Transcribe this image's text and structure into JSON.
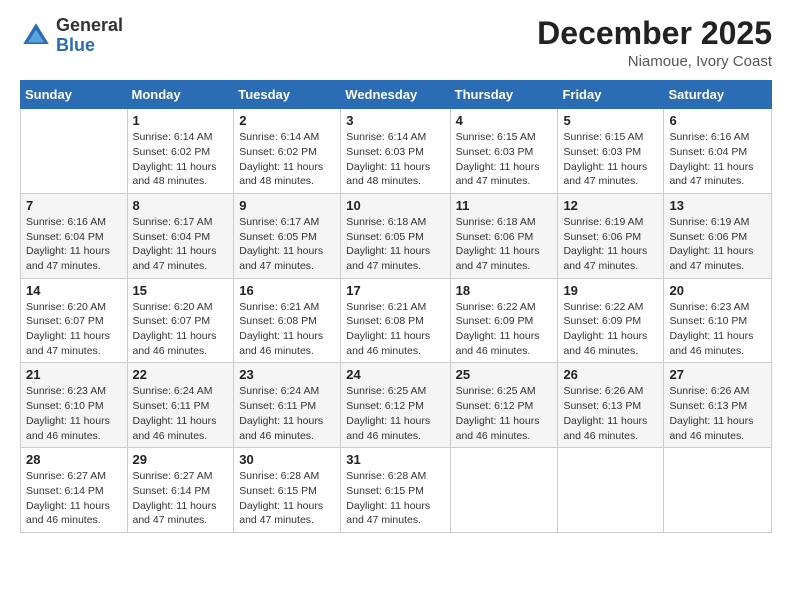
{
  "logo": {
    "general": "General",
    "blue": "Blue"
  },
  "title": "December 2025",
  "location": "Niamoue, Ivory Coast",
  "days_header": [
    "Sunday",
    "Monday",
    "Tuesday",
    "Wednesday",
    "Thursday",
    "Friday",
    "Saturday"
  ],
  "weeks": [
    [
      {
        "day": "",
        "info": ""
      },
      {
        "day": "1",
        "info": "Sunrise: 6:14 AM\nSunset: 6:02 PM\nDaylight: 11 hours\nand 48 minutes."
      },
      {
        "day": "2",
        "info": "Sunrise: 6:14 AM\nSunset: 6:02 PM\nDaylight: 11 hours\nand 48 minutes."
      },
      {
        "day": "3",
        "info": "Sunrise: 6:14 AM\nSunset: 6:03 PM\nDaylight: 11 hours\nand 48 minutes."
      },
      {
        "day": "4",
        "info": "Sunrise: 6:15 AM\nSunset: 6:03 PM\nDaylight: 11 hours\nand 47 minutes."
      },
      {
        "day": "5",
        "info": "Sunrise: 6:15 AM\nSunset: 6:03 PM\nDaylight: 11 hours\nand 47 minutes."
      },
      {
        "day": "6",
        "info": "Sunrise: 6:16 AM\nSunset: 6:04 PM\nDaylight: 11 hours\nand 47 minutes."
      }
    ],
    [
      {
        "day": "7",
        "info": "Sunrise: 6:16 AM\nSunset: 6:04 PM\nDaylight: 11 hours\nand 47 minutes."
      },
      {
        "day": "8",
        "info": "Sunrise: 6:17 AM\nSunset: 6:04 PM\nDaylight: 11 hours\nand 47 minutes."
      },
      {
        "day": "9",
        "info": "Sunrise: 6:17 AM\nSunset: 6:05 PM\nDaylight: 11 hours\nand 47 minutes."
      },
      {
        "day": "10",
        "info": "Sunrise: 6:18 AM\nSunset: 6:05 PM\nDaylight: 11 hours\nand 47 minutes."
      },
      {
        "day": "11",
        "info": "Sunrise: 6:18 AM\nSunset: 6:06 PM\nDaylight: 11 hours\nand 47 minutes."
      },
      {
        "day": "12",
        "info": "Sunrise: 6:19 AM\nSunset: 6:06 PM\nDaylight: 11 hours\nand 47 minutes."
      },
      {
        "day": "13",
        "info": "Sunrise: 6:19 AM\nSunset: 6:06 PM\nDaylight: 11 hours\nand 47 minutes."
      }
    ],
    [
      {
        "day": "14",
        "info": "Sunrise: 6:20 AM\nSunset: 6:07 PM\nDaylight: 11 hours\nand 47 minutes."
      },
      {
        "day": "15",
        "info": "Sunrise: 6:20 AM\nSunset: 6:07 PM\nDaylight: 11 hours\nand 46 minutes."
      },
      {
        "day": "16",
        "info": "Sunrise: 6:21 AM\nSunset: 6:08 PM\nDaylight: 11 hours\nand 46 minutes."
      },
      {
        "day": "17",
        "info": "Sunrise: 6:21 AM\nSunset: 6:08 PM\nDaylight: 11 hours\nand 46 minutes."
      },
      {
        "day": "18",
        "info": "Sunrise: 6:22 AM\nSunset: 6:09 PM\nDaylight: 11 hours\nand 46 minutes."
      },
      {
        "day": "19",
        "info": "Sunrise: 6:22 AM\nSunset: 6:09 PM\nDaylight: 11 hours\nand 46 minutes."
      },
      {
        "day": "20",
        "info": "Sunrise: 6:23 AM\nSunset: 6:10 PM\nDaylight: 11 hours\nand 46 minutes."
      }
    ],
    [
      {
        "day": "21",
        "info": "Sunrise: 6:23 AM\nSunset: 6:10 PM\nDaylight: 11 hours\nand 46 minutes."
      },
      {
        "day": "22",
        "info": "Sunrise: 6:24 AM\nSunset: 6:11 PM\nDaylight: 11 hours\nand 46 minutes."
      },
      {
        "day": "23",
        "info": "Sunrise: 6:24 AM\nSunset: 6:11 PM\nDaylight: 11 hours\nand 46 minutes."
      },
      {
        "day": "24",
        "info": "Sunrise: 6:25 AM\nSunset: 6:12 PM\nDaylight: 11 hours\nand 46 minutes."
      },
      {
        "day": "25",
        "info": "Sunrise: 6:25 AM\nSunset: 6:12 PM\nDaylight: 11 hours\nand 46 minutes."
      },
      {
        "day": "26",
        "info": "Sunrise: 6:26 AM\nSunset: 6:13 PM\nDaylight: 11 hours\nand 46 minutes."
      },
      {
        "day": "27",
        "info": "Sunrise: 6:26 AM\nSunset: 6:13 PM\nDaylight: 11 hours\nand 46 minutes."
      }
    ],
    [
      {
        "day": "28",
        "info": "Sunrise: 6:27 AM\nSunset: 6:14 PM\nDaylight: 11 hours\nand 46 minutes."
      },
      {
        "day": "29",
        "info": "Sunrise: 6:27 AM\nSunset: 6:14 PM\nDaylight: 11 hours\nand 47 minutes."
      },
      {
        "day": "30",
        "info": "Sunrise: 6:28 AM\nSunset: 6:15 PM\nDaylight: 11 hours\nand 47 minutes."
      },
      {
        "day": "31",
        "info": "Sunrise: 6:28 AM\nSunset: 6:15 PM\nDaylight: 11 hours\nand 47 minutes."
      },
      {
        "day": "",
        "info": ""
      },
      {
        "day": "",
        "info": ""
      },
      {
        "day": "",
        "info": ""
      }
    ]
  ]
}
